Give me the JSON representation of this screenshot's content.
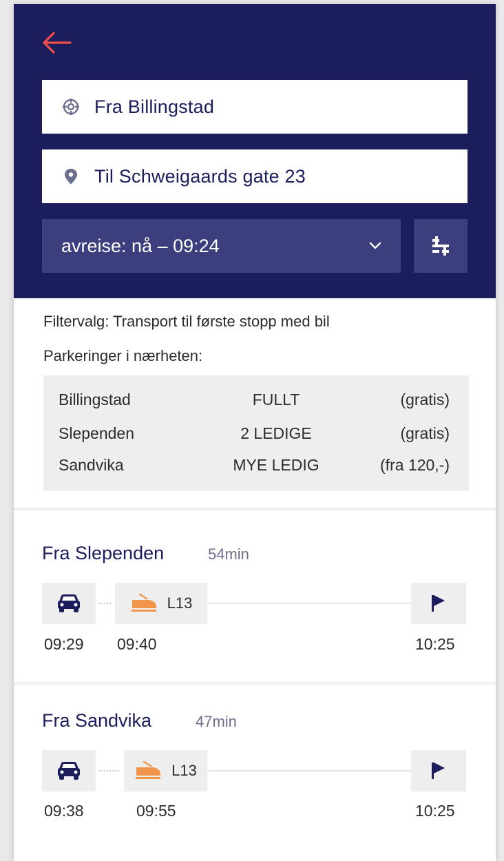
{
  "search": {
    "from_value": "Fra Billingstad",
    "to_value": "Til Schweigaards gate 23",
    "departure_label": "avreise: nå – 09:24"
  },
  "filter_text": "Filtervalg: Transport til første stopp med bil",
  "parking": {
    "title": "Parkeringer i nærheten:",
    "rows": [
      {
        "place": "Billingstad",
        "status": "FULLT",
        "price": "(gratis)"
      },
      {
        "place": "Slependen",
        "status": "2 LEDIGE",
        "price": "(gratis)"
      },
      {
        "place": "Sandvika",
        "status": "MYE LEDIG",
        "price": "(fra 120,-)"
      }
    ]
  },
  "trips": [
    {
      "title": "Fra Slependen",
      "duration": "54min",
      "line": "L13",
      "car_time": "09:29",
      "train_time": "09:40",
      "arrival_time": "10:25"
    },
    {
      "title": "Fra Sandvika",
      "duration": "47min",
      "line": "L13",
      "car_time": "09:38",
      "train_time": "09:55",
      "arrival_time": "10:25"
    }
  ],
  "colors": {
    "header_bg": "#1b1d5c",
    "control_bg": "#3c3e7d",
    "back_arrow": "#f0504a",
    "train_icon": "#f0954a",
    "text_dark": "#2c2c2c",
    "text_navy": "#1b1d5c"
  },
  "icons": {
    "back": "arrow-left-icon",
    "from": "crosshair-icon",
    "to": "map-pin-icon",
    "dropdown": "chevron-down-icon",
    "filter": "filter-sliders-icon",
    "car": "car-icon",
    "train": "train-icon",
    "destination": "flag-icon"
  }
}
